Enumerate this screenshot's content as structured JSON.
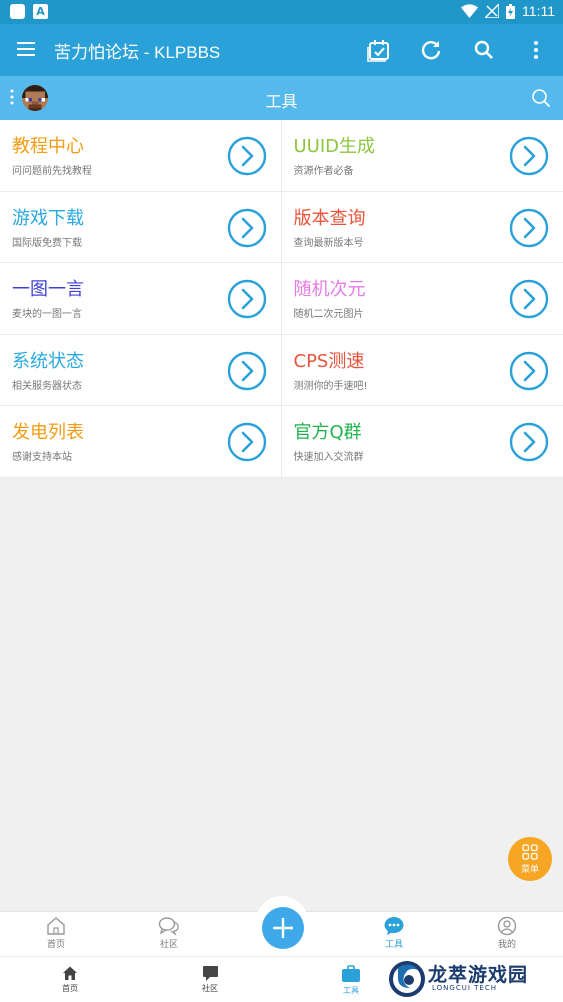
{
  "status_bar": {
    "time": "11:11",
    "app_badge": "A"
  },
  "app_bar": {
    "title": "苦力怕论坛 - KLPBBS"
  },
  "sub_bar": {
    "title": "工具"
  },
  "tools": [
    {
      "title": "教程中心",
      "desc": "问问题前先找教程",
      "color": "#f39c12"
    },
    {
      "title": "UUID生成",
      "desc": "资源作者必备",
      "color": "#8cc63f"
    },
    {
      "title": "游戏下载",
      "desc": "国际版免费下载",
      "color": "#29a9e0"
    },
    {
      "title": "版本查询",
      "desc": "查询最新版本号",
      "color": "#e8543c"
    },
    {
      "title": "一图一言",
      "desc": "麦块的一图一言",
      "color": "#3f3fd9"
    },
    {
      "title": "随机次元",
      "desc": "随机二次元图片",
      "color": "#e879e8"
    },
    {
      "title": "系统状态",
      "desc": "相关服务器状态",
      "color": "#29a9e0"
    },
    {
      "title": "CPS测速",
      "desc": "测测你的手速吧!",
      "color": "#e8543c"
    },
    {
      "title": "发电列表",
      "desc": "感谢支持本站",
      "color": "#f39c12"
    },
    {
      "title": "官方Q群",
      "desc": "快速加入交流群",
      "color": "#22b14c"
    }
  ],
  "fab_menu": {
    "label": "菜单"
  },
  "tab_bar": {
    "home": "首页",
    "community": "社区",
    "tools": "工具",
    "mine": "我的"
  },
  "system_tab_bar": {
    "home": "首页",
    "community": "社区",
    "tools": "工具"
  },
  "watermark": {
    "text": "龙萃游戏园",
    "sub": "LONGCUI TECH"
  },
  "colors": {
    "primary": "#2aa2d9",
    "subbar": "#55b9ee",
    "accent_orange": "#f6a623"
  }
}
